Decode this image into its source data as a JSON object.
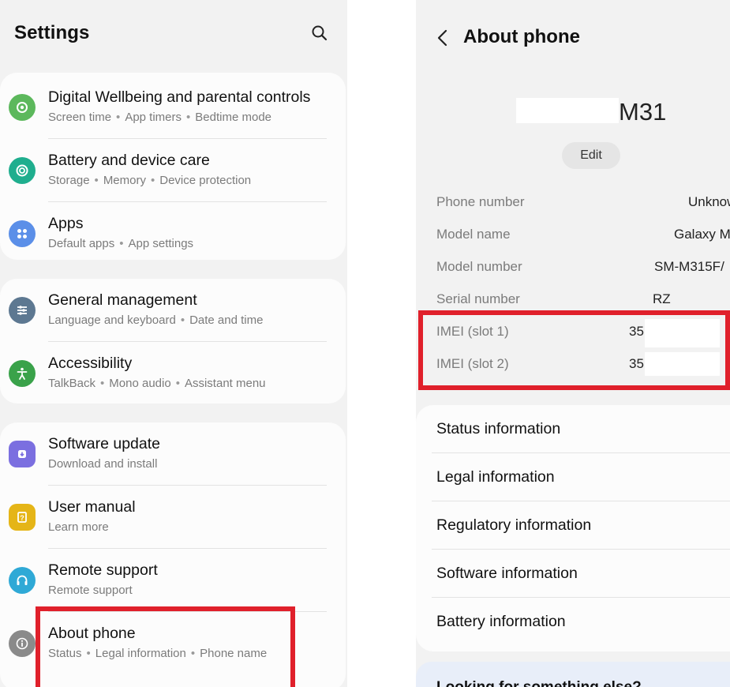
{
  "settings": {
    "title": "Settings",
    "search_icon": "search-icon",
    "items": [
      {
        "title": "Digital Wellbeing and parental controls",
        "subs": [
          "Screen time",
          "App timers",
          "Bedtime mode"
        ],
        "icon": "digital-wellbeing-icon",
        "color": "#5cb85c"
      },
      {
        "title": "Battery and device care",
        "subs": [
          "Storage",
          "Memory",
          "Device protection"
        ],
        "icon": "device-care-icon",
        "color": "#1fae8e"
      },
      {
        "title": "Apps",
        "subs": [
          "Default apps",
          "App settings"
        ],
        "icon": "apps-icon",
        "color": "#5b8fe8"
      },
      {
        "title": "General management",
        "subs": [
          "Language and keyboard",
          "Date and time"
        ],
        "icon": "general-management-icon",
        "color": "#5d7891"
      },
      {
        "title": "Accessibility",
        "subs": [
          "TalkBack",
          "Mono audio",
          "Assistant menu"
        ],
        "icon": "accessibility-icon",
        "color": "#3aa24a"
      },
      {
        "title": "Software update",
        "subs": [
          "Download and install"
        ],
        "icon": "software-update-icon",
        "color": "#7b6fe0"
      },
      {
        "title": "User manual",
        "subs": [
          "Learn more"
        ],
        "icon": "user-manual-icon",
        "color": "#e5b517"
      },
      {
        "title": "Remote support",
        "subs": [
          "Remote support"
        ],
        "icon": "remote-support-icon",
        "color": "#2fa9d6"
      },
      {
        "title": "About phone",
        "subs": [
          "Status",
          "Legal information",
          "Phone name"
        ],
        "icon": "info-icon",
        "color": "#8a8a8a"
      }
    ]
  },
  "about": {
    "title": "About phone",
    "device_name": "M31",
    "edit_label": "Edit",
    "rows": [
      {
        "label": "Phone number",
        "value": "Unknow"
      },
      {
        "label": "Model name",
        "value": "Galaxy M"
      },
      {
        "label": "Model number",
        "value": "SM-M315F/"
      },
      {
        "label": "Serial number",
        "value": "RZ"
      },
      {
        "label": "IMEI (slot 1)",
        "value": "35"
      },
      {
        "label": "IMEI (slot 2)",
        "value": "35"
      }
    ],
    "menu": [
      "Status information",
      "Legal information",
      "Regulatory information",
      "Software information",
      "Battery information"
    ],
    "looking_for": "Looking for something else?"
  },
  "highlight_color": "#e0202b"
}
